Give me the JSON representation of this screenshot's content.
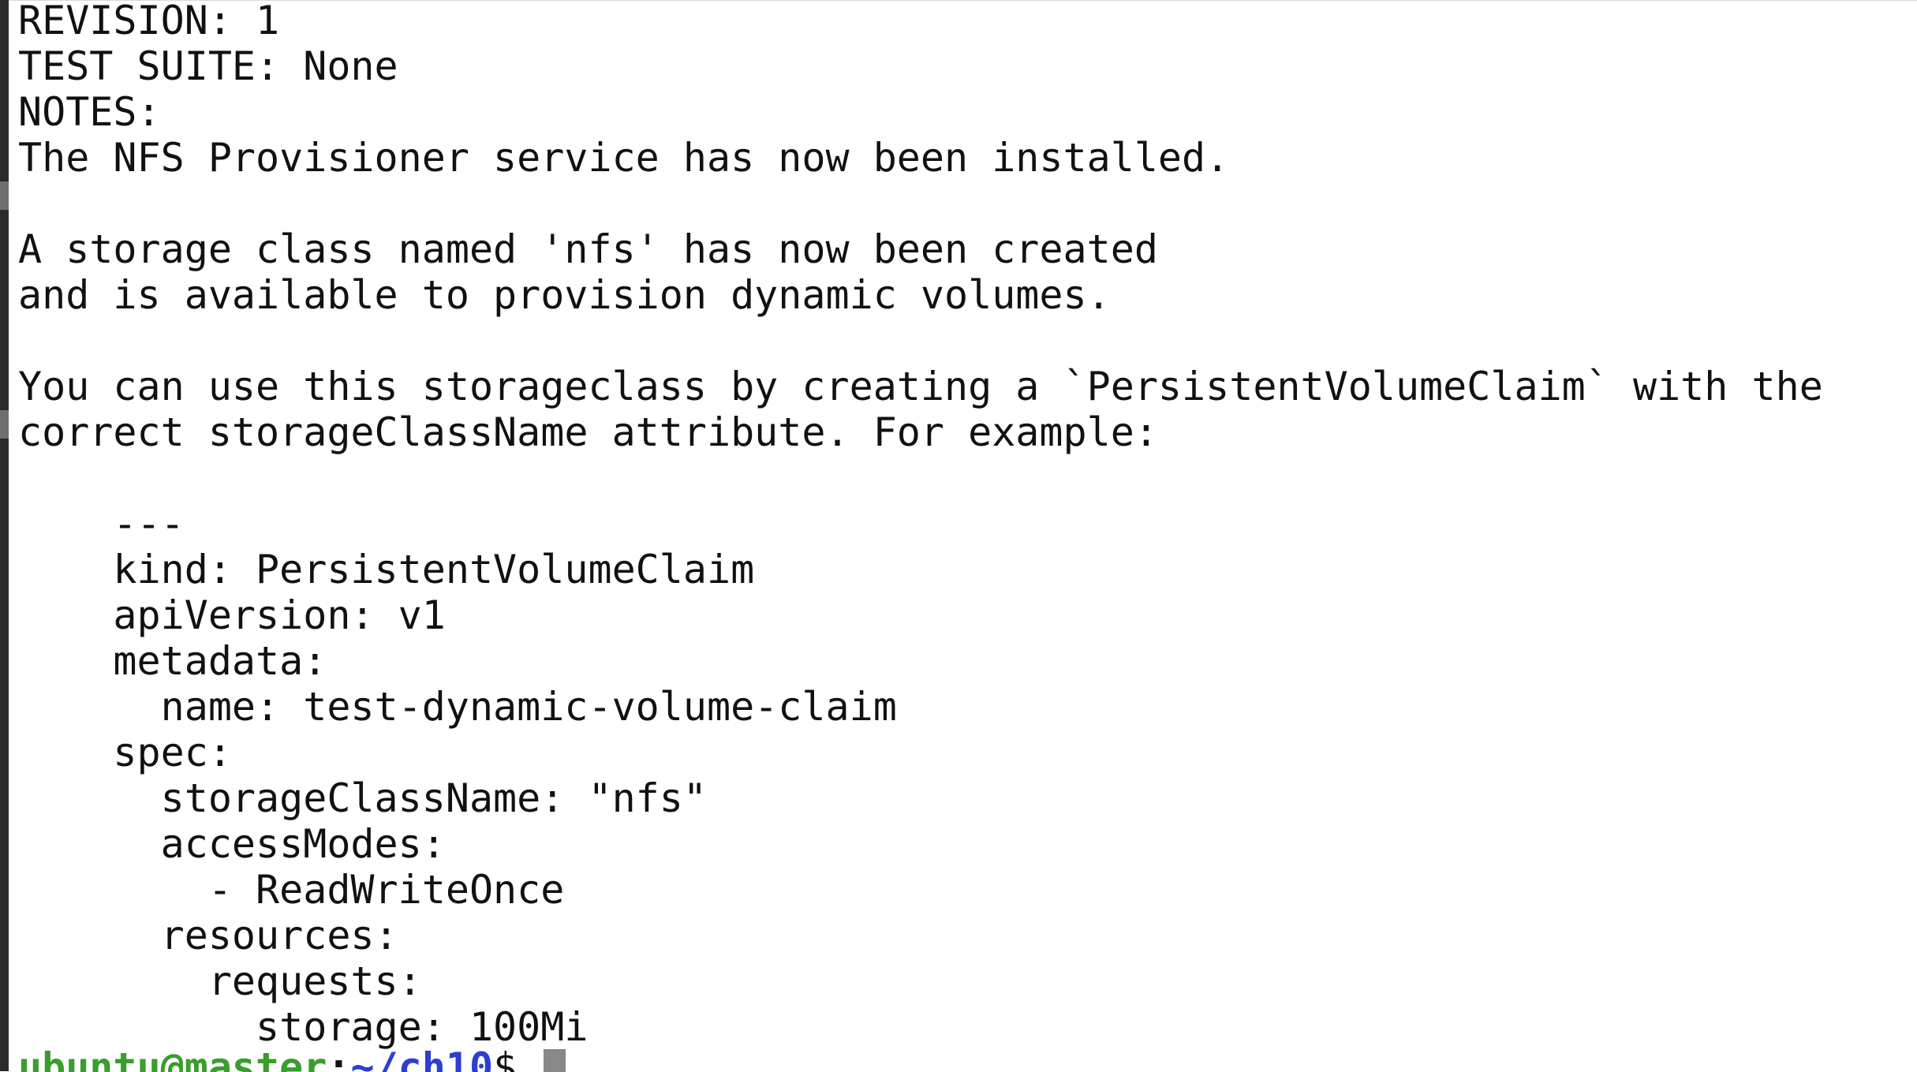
{
  "terminal": {
    "lines": [
      "REVISION: 1",
      "TEST SUITE: None",
      "NOTES:",
      "The NFS Provisioner service has now been installed.",
      "",
      "A storage class named 'nfs' has now been created",
      "and is available to provision dynamic volumes.",
      "",
      "You can use this storageclass by creating a `PersistentVolumeClaim` with the",
      "correct storageClassName attribute. For example:",
      "",
      "    ---",
      "    kind: PersistentVolumeClaim",
      "    apiVersion: v1",
      "    metadata:",
      "      name: test-dynamic-volume-claim",
      "    spec:",
      "      storageClassName: \"nfs\"",
      "      accessModes:",
      "        - ReadWriteOnce",
      "      resources:",
      "        requests:",
      "          storage: 100Mi"
    ],
    "prompt": {
      "user_host": "ubuntu@master",
      "separator": ":",
      "path": "~/ch10",
      "symbol": "$ "
    }
  },
  "colors": {
    "background": "#ffffff",
    "text": "#111111",
    "prompt_user": "#3a9d2e",
    "prompt_path": "#2c3fd0",
    "cursor": "#888888"
  }
}
